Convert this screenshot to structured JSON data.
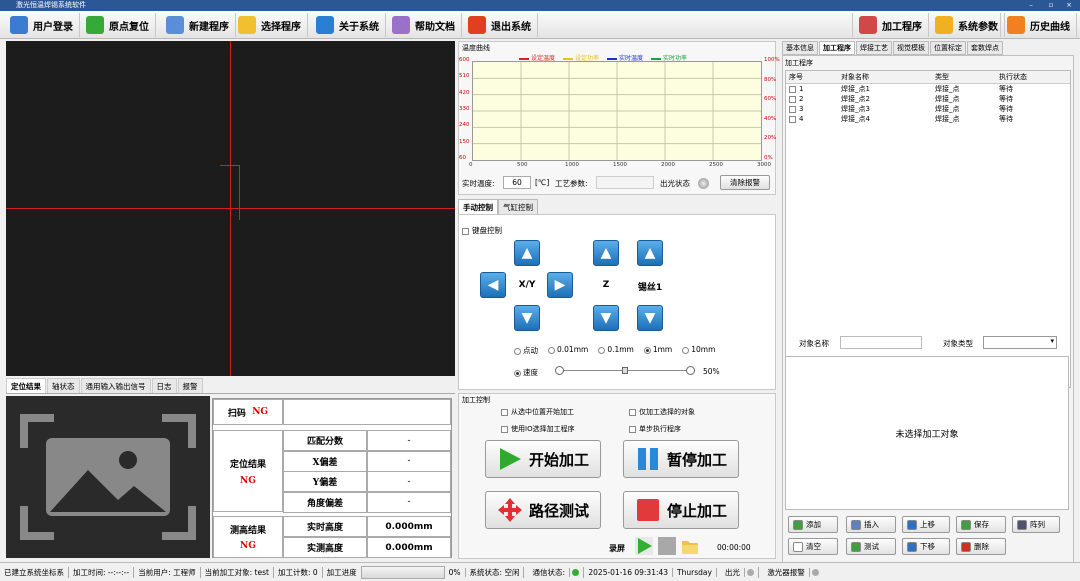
{
  "window": {
    "title": "激光恒温焊锡系统软件",
    "minimize": "–",
    "maximize": "▫",
    "close": "×"
  },
  "toolbar": {
    "left": [
      {
        "label": "用户登录",
        "icon": "users-icon",
        "color": "#3b7bd0"
      },
      {
        "label": "原点复位",
        "icon": "recycle-icon",
        "color": "#37a83a"
      },
      {
        "label": "新建程序",
        "icon": "new-file-icon",
        "color": "#5a8fd8"
      },
      {
        "label": "选择程序",
        "icon": "folder-icon",
        "color": "#f0c030"
      },
      {
        "label": "关于系统",
        "icon": "info-icon",
        "color": "#2a7fd4"
      },
      {
        "label": "帮助文档",
        "icon": "help-icon",
        "color": "#9a70c8"
      },
      {
        "label": "退出系统",
        "icon": "exit-icon",
        "color": "#e04020"
      }
    ],
    "right": [
      {
        "label": "加工程序",
        "icon": "tools-icon",
        "color": "#d04848"
      },
      {
        "label": "系统参数",
        "icon": "gear-icon",
        "color": "#f0b020"
      },
      {
        "label": "历史曲线",
        "icon": "chart-icon",
        "color": "#f08020"
      }
    ]
  },
  "bottom_tabs": [
    "定位结果",
    "轴状态",
    "通用输入输出信号",
    "日志",
    "报警"
  ],
  "scan": {
    "label": "扫码",
    "value": "NG"
  },
  "locate": {
    "label": "定位结果",
    "value": "NG",
    "rows": [
      {
        "k": "匹配分数",
        "v": "-"
      },
      {
        "k": "X偏差",
        "v": "-"
      },
      {
        "k": "Y偏差",
        "v": "-"
      },
      {
        "k": "角度偏差",
        "v": "-"
      }
    ]
  },
  "height": {
    "label": "测高结果",
    "value": "NG",
    "rows": [
      {
        "k": "实时高度",
        "v": "0.000mm"
      },
      {
        "k": "实测高度",
        "v": "0.000mm"
      }
    ]
  },
  "chart": {
    "group_title": "温度曲线",
    "legend": [
      "设定温度",
      "设定功率",
      "实时温度",
      "实时功率"
    ],
    "legend_colors": [
      "#e02020",
      "#e8c020",
      "#2030d0",
      "#20a040"
    ],
    "yleft": [
      "600",
      "510",
      "420",
      "330",
      "240",
      "150",
      "60"
    ],
    "yright": [
      "100%",
      "80%",
      "60%",
      "40%",
      "20%",
      "0%"
    ],
    "xticks": [
      "0",
      "500",
      "1000",
      "1500",
      "2000",
      "2500",
      "3000"
    ]
  },
  "chart_data": {
    "type": "line",
    "categories": [
      "0",
      "500",
      "1000",
      "1500",
      "2000",
      "2500",
      "3000"
    ],
    "series": [
      {
        "name": "设定温度",
        "values": []
      },
      {
        "name": "设定功率",
        "values": []
      },
      {
        "name": "实时温度",
        "values": []
      },
      {
        "name": "实时功率",
        "values": []
      }
    ],
    "ylim": [
      60,
      600
    ],
    "ylim_right": [
      "0%",
      "100%"
    ],
    "xlim": [
      0,
      3000
    ],
    "grid": true,
    "legend": "top"
  },
  "temp": {
    "label": "实时温度:",
    "value": "60",
    "unit": "[℃]",
    "param_label": "工艺参数:",
    "laser_label": "出光状态",
    "clear_btn": "清除报警"
  },
  "manual": {
    "tabs": [
      "手动控制",
      "气缸控制"
    ],
    "keyboard": "键盘控制",
    "xy": "X/Y",
    "z": "Z",
    "wire": "锡丝1",
    "modes": [
      "点动",
      "0.01mm",
      "0.1mm",
      "1mm",
      "10mm"
    ],
    "selected": 3,
    "speed_label": "速度",
    "speed_value": "50%",
    "speed_fraction": 0.5
  },
  "process": {
    "title": "加工控制",
    "opts": [
      "从选中位置开始加工",
      "仅加工选择的对象",
      "使用IO选择加工程序",
      "单步执行程序"
    ],
    "start": "开始加工",
    "pause": "暂停加工",
    "path": "路径测试",
    "stop": "停止加工",
    "record": "录屏",
    "time": "00:00:00"
  },
  "right_tabs": [
    "基本信息",
    "加工程序",
    "焊接工艺",
    "视觉模板",
    "位置标定",
    "套数焊点"
  ],
  "program": {
    "title": "加工程序",
    "cols": [
      "序号",
      "对象名称",
      "类型",
      "执行状态"
    ],
    "rows": [
      {
        "n": "1",
        "name": "焊接_点1",
        "type": "焊接_点",
        "state": "等待"
      },
      {
        "n": "2",
        "name": "焊接_点2",
        "type": "焊接_点",
        "state": "等待"
      },
      {
        "n": "3",
        "name": "焊接_点3",
        "type": "焊接_点",
        "state": "等待"
      },
      {
        "n": "4",
        "name": "焊接_点4",
        "type": "焊接_点",
        "state": "等待"
      }
    ]
  },
  "object": {
    "name_label": "对象名称",
    "type_label": "对象类型",
    "empty": "未选择加工对象"
  },
  "side_buttons": [
    {
      "label": "添加",
      "color": "#40a040"
    },
    {
      "label": "插入",
      "color": "#6080c0"
    },
    {
      "label": "上移",
      "color": "#3070c0"
    },
    {
      "label": "保存",
      "color": "#40a040"
    },
    {
      "label": "阵列",
      "color": "#505070"
    },
    {
      "label": "清空",
      "color": "#ffffff"
    },
    {
      "label": "测试",
      "color": "#40a040"
    },
    {
      "label": "下移",
      "color": "#3070c0"
    },
    {
      "label": "删除",
      "color": "#d03020"
    }
  ],
  "status": {
    "coord": "已建立系统坐标系",
    "time": "加工时间: --:--:--",
    "user": "当前用户: 工程师",
    "target": "当前加工对象: test",
    "count": "加工计数: 0",
    "progress_label": "加工进度",
    "progress": "0%",
    "sys": "系统状态: 空闲",
    "comm": "通信状态:",
    "date": "2025-01-16 09:31:43",
    "day": "Thursday",
    "laser": "出光",
    "alarm": "激光器报警"
  }
}
